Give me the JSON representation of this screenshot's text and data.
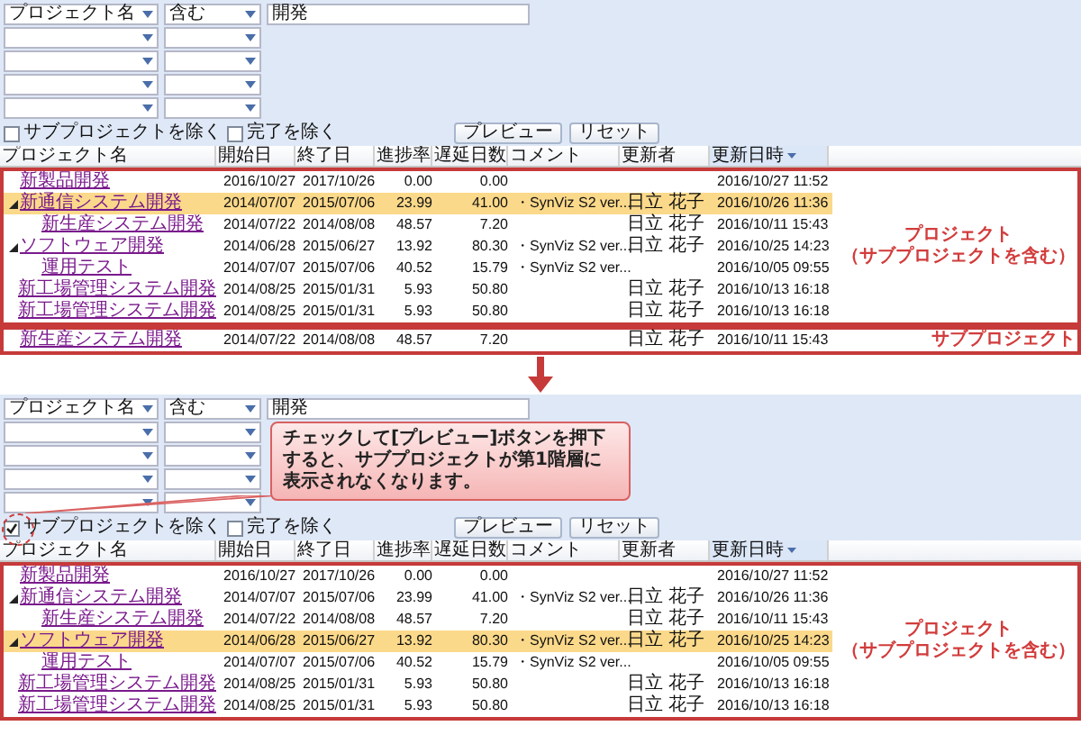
{
  "panels": [
    {
      "filters": [
        {
          "kind": "condition",
          "field": "プロジェクト名",
          "operator": "含む",
          "value": "開発"
        },
        {
          "kind": "empty"
        },
        {
          "kind": "empty"
        },
        {
          "kind": "empty"
        },
        {
          "kind": "empty"
        }
      ],
      "options": [
        {
          "label": "サブプロジェクトを除く",
          "checked": false
        },
        {
          "label": "完了を除く",
          "checked": false
        }
      ],
      "buttons": [
        "プレビュー",
        "リセット"
      ],
      "columns": [
        {
          "label": "プロジェクト名",
          "sorted": false
        },
        {
          "label": "開始日",
          "sorted": false
        },
        {
          "label": "終了日",
          "sorted": false
        },
        {
          "label": "進捗率",
          "sorted": false
        },
        {
          "label": "遅延日数",
          "sorted": false
        },
        {
          "label": "コメント",
          "sorted": false
        },
        {
          "label": "更新者",
          "sorted": false
        },
        {
          "label": "更新日時",
          "sorted": true
        }
      ],
      "groups": [
        {
          "annotation": [
            "プロジェクト",
            "（サブプロジェクトを含む）"
          ],
          "rows": [
            {
              "name": "新製品開発",
              "start": "2016/10/27",
              "end": "2017/10/26",
              "progress": "0.00",
              "delay": "0.00",
              "updated": "2016/10/27 11:52",
              "selected": false
            },
            {
              "name": "新通信システム開発",
              "start": "2014/07/07",
              "end": "2015/07/06",
              "progress": "23.99",
              "delay": "41.00",
              "comment": "・SynViz S2 ver...",
              "updater": "日立 花子",
              "updated": "2016/10/26 11:36",
              "selected": true,
              "expanded": true,
              "children": [
                {
                  "name": "新生産システム開発",
                  "start": "2014/07/22",
                  "end": "2014/08/08",
                  "progress": "48.57",
                  "delay": "7.20",
                  "updater": "日立 花子",
                  "updated": "2016/10/11 15:43",
                  "selected": false
                }
              ]
            },
            {
              "name": "ソフトウェア開発",
              "start": "2014/06/28",
              "end": "2015/06/27",
              "progress": "13.92",
              "delay": "80.30",
              "comment": "・SynViz S2 ver...",
              "updater": "日立 花子",
              "updated": "2016/10/25 14:23",
              "selected": false,
              "expanded": true,
              "children": [
                {
                  "name": "運用テスト",
                  "start": "2014/07/07",
                  "end": "2015/07/06",
                  "progress": "40.52",
                  "delay": "15.79",
                  "comment": "・SynViz S2 ver...",
                  "updated": "2016/10/05 09:55",
                  "selected": false
                }
              ]
            },
            {
              "name": "新工場管理システム開発",
              "start": "2014/08/25",
              "end": "2015/01/31",
              "progress": "5.93",
              "delay": "50.80",
              "updater": "日立 花子",
              "updated": "2016/10/13 16:18",
              "selected": false
            },
            {
              "name": "新工場管理システム開発",
              "start": "2014/08/25",
              "end": "2015/01/31",
              "progress": "5.93",
              "delay": "50.80",
              "updater": "日立 花子",
              "updated": "2016/10/13 16:18",
              "selected": false
            }
          ]
        },
        {
          "annotation": [
            "サブプロジェクト"
          ],
          "rows": [
            {
              "name": "新生産システム開発",
              "start": "2014/07/22",
              "end": "2014/08/08",
              "progress": "48.57",
              "delay": "7.20",
              "updater": "日立 花子",
              "updated": "2016/10/11 15:43",
              "selected": false
            }
          ]
        }
      ]
    },
    {
      "filters": [
        {
          "kind": "condition",
          "field": "プロジェクト名",
          "operator": "含む",
          "value": "開発"
        },
        {
          "kind": "empty"
        },
        {
          "kind": "empty"
        },
        {
          "kind": "empty"
        },
        {
          "kind": "empty"
        }
      ],
      "options": [
        {
          "label": "サブプロジェクトを除く",
          "checked": true
        },
        {
          "label": "完了を除く",
          "checked": false
        }
      ],
      "buttons": [
        "プレビュー",
        "リセット"
      ],
      "callout": "チェックして[プレビュー]ボタンを押下すると、サブプロジェクトが第1階層に表示されなくなります。",
      "columns": [
        {
          "label": "プロジェクト名",
          "sorted": false
        },
        {
          "label": "開始日",
          "sorted": false
        },
        {
          "label": "終了日",
          "sorted": false
        },
        {
          "label": "進捗率",
          "sorted": false
        },
        {
          "label": "遅延日数",
          "sorted": false
        },
        {
          "label": "コメント",
          "sorted": false
        },
        {
          "label": "更新者",
          "sorted": false
        },
        {
          "label": "更新日時",
          "sorted": true
        }
      ],
      "groups": [
        {
          "annotation": [
            "プロジェクト",
            "（サブプロジェクトを含む）"
          ],
          "rows": [
            {
              "name": "新製品開発",
              "start": "2016/10/27",
              "end": "2017/10/26",
              "progress": "0.00",
              "delay": "0.00",
              "updated": "2016/10/27 11:52",
              "selected": false
            },
            {
              "name": "新通信システム開発",
              "start": "2014/07/07",
              "end": "2015/07/06",
              "progress": "23.99",
              "delay": "41.00",
              "comment": "・SynViz S2 ver...",
              "updater": "日立 花子",
              "updated": "2016/10/26 11:36",
              "selected": false,
              "expanded": true,
              "children": [
                {
                  "name": "新生産システム開発",
                  "start": "2014/07/22",
                  "end": "2014/08/08",
                  "progress": "48.57",
                  "delay": "7.20",
                  "updater": "日立 花子",
                  "updated": "2016/10/11 15:43",
                  "selected": false
                }
              ]
            },
            {
              "name": "ソフトウェア開発",
              "start": "2014/06/28",
              "end": "2015/06/27",
              "progress": "13.92",
              "delay": "80.30",
              "comment": "・SynViz S2 ver...",
              "updater": "日立 花子",
              "updated": "2016/10/25 14:23",
              "selected": true,
              "expanded": true,
              "children": [
                {
                  "name": "運用テスト",
                  "start": "2014/07/07",
                  "end": "2015/07/06",
                  "progress": "40.52",
                  "delay": "15.79",
                  "comment": "・SynViz S2 ver...",
                  "updated": "2016/10/05 09:55",
                  "selected": false
                }
              ]
            },
            {
              "name": "新工場管理システム開発",
              "start": "2014/08/25",
              "end": "2015/01/31",
              "progress": "5.93",
              "delay": "50.80",
              "updater": "日立 花子",
              "updated": "2016/10/13 16:18",
              "selected": false
            },
            {
              "name": "新工場管理システム開発",
              "start": "2014/08/25",
              "end": "2015/01/31",
              "progress": "5.93",
              "delay": "50.80",
              "updater": "日立 花子",
              "updated": "2016/10/13 16:18",
              "selected": false
            }
          ]
        }
      ]
    }
  ]
}
